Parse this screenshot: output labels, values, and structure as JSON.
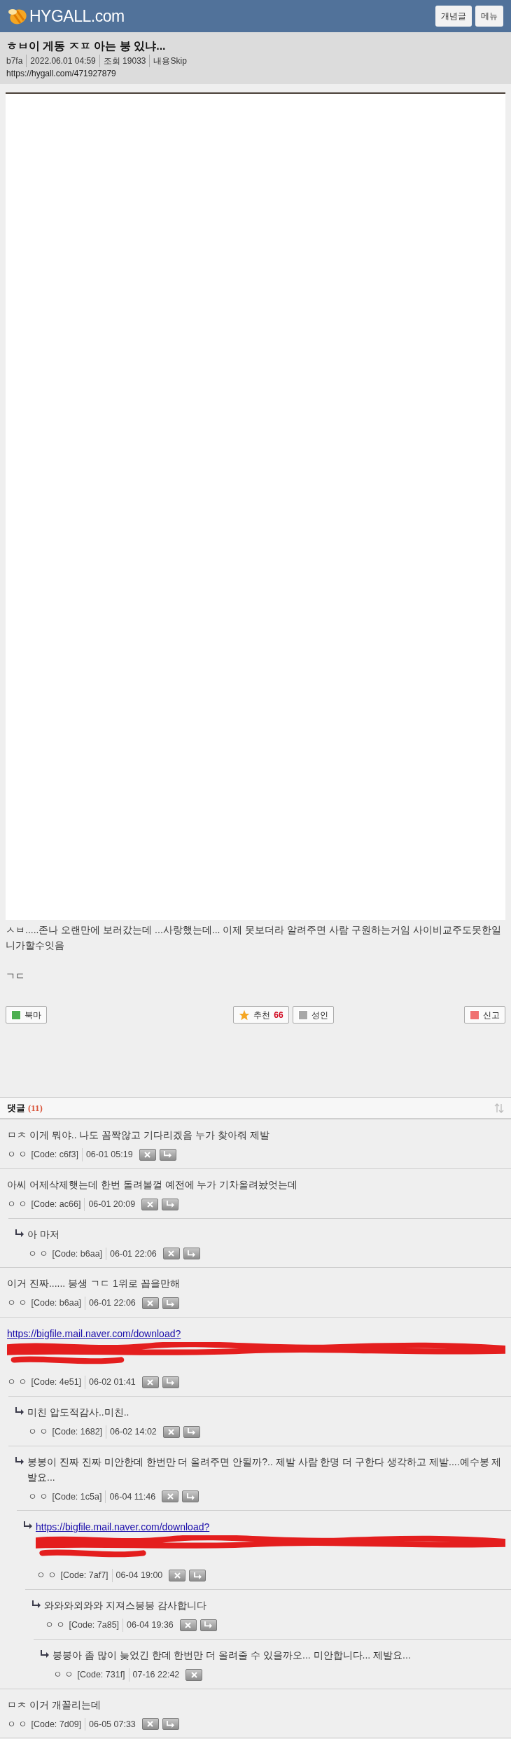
{
  "header": {
    "logo_text": "HYGALL.com",
    "buttons": [
      "개념글",
      "메뉴"
    ]
  },
  "post": {
    "title": "ㅎㅂ이 게동 ㅈㅍ 아는 붕 있냐...",
    "meta": [
      "b7fa",
      "2022.06.01 04:59",
      "조회 19033",
      "내용Skip"
    ],
    "url": "https://hygall.com/471927879",
    "paragraphs": [
      "ㅅㅂ.....존나 오랜만에 보러갔는데 ...사랑했는데... 이제 못보더라 알려주면 사람 구원하는거임 사이비교주도못한일 니가할수잇음",
      "ㄱㄷ"
    ]
  },
  "actions": [
    {
      "label": "북마",
      "kind": "square",
      "color": "#4caf50"
    },
    {
      "label": "추천",
      "kind": "star",
      "count": "66"
    },
    {
      "label": "성인",
      "kind": "square",
      "color": "#a8a8a8"
    },
    {
      "label": "신고",
      "kind": "square",
      "color": "#f07070"
    }
  ],
  "comments_header": {
    "label": "댓글",
    "count": "(11)"
  },
  "comments": [
    {
      "kind": "text",
      "text": "ㅁㅊ 이게 뭐야.. 나도 꼼짝않고 기다리겠음 누가 찾아줘 제발",
      "author": "ㅇ ㅇ",
      "code": "[Code: c6f3]",
      "date": "06-01 05:19",
      "can_reply": true
    },
    {
      "kind": "text",
      "text": "아씨 어제삭제햇는데 한번 돌려볼껄 예전에 누가 기차올려놨엇는데",
      "author": "ㅇ ㅇ",
      "code": "[Code: ac66]",
      "date": "06-01 20:09",
      "can_reply": true,
      "children": [
        {
          "kind": "text",
          "text": "아 마저",
          "author": "ㅇ ㅇ",
          "code": "[Code: b6aa]",
          "date": "06-01 22:06",
          "can_reply": true
        }
      ]
    },
    {
      "kind": "text",
      "text": "이거 진짜...... 붕생 ㄱㄷ 1위로 꼽을만해",
      "author": "ㅇ ㅇ",
      "code": "[Code: b6aa]",
      "date": "06-01 22:06",
      "can_reply": true
    },
    {
      "kind": "link",
      "text": "https://bigfile.mail.naver.com/download?",
      "author": "ㅇ ㅇ",
      "code": "[Code: 4e51]",
      "date": "06-02 01:41",
      "can_reply": true,
      "children": [
        {
          "kind": "text",
          "text": "미친 압도적감사..미친..",
          "author": "ㅇ ㅇ",
          "code": "[Code: 1682]",
          "date": "06-02 14:02",
          "can_reply": true
        },
        {
          "kind": "text",
          "text": "봉봉이 진짜 진짜 미안한데 한번만 더 올려주면 안될까?.. 제발 사람 한명 더 구한다 생각하고 제발....예수봉 제발요...",
          "author": "ㅇ ㅇ",
          "code": "[Code: 1c5a]",
          "date": "06-04 11:46",
          "can_reply": true,
          "children": [
            {
              "kind": "link",
              "text": "https://bigfile.mail.naver.com/download?",
              "author": "ㅇ ㅇ",
              "code": "[Code: 7af7]",
              "date": "06-04 19:00",
              "can_reply": true,
              "children": [
                {
                  "kind": "text",
                  "text": "와와와외와와 지져스붕붕 감사합니다",
                  "author": "ㅇ ㅇ",
                  "code": "[Code: 7a85]",
                  "date": "06-04 19:36",
                  "can_reply": true,
                  "children": [
                    {
                      "kind": "text",
                      "text": "붕붕아 좀 많이 늦었긴 한데 한번만 더 올려줄 수 있을까오... 미안합니다... 제발요...",
                      "author": "ㅇ ㅇ",
                      "code": "[Code: 731f]",
                      "date": "07-16 22:42",
                      "can_reply": false
                    }
                  ]
                }
              ]
            }
          ]
        }
      ]
    },
    {
      "kind": "text",
      "text": "ㅁㅊ 이거 개꼴리는데",
      "author": "ㅇ ㅇ",
      "code": "[Code: 7d09]",
      "date": "06-05 07:33",
      "can_reply": true
    }
  ]
}
